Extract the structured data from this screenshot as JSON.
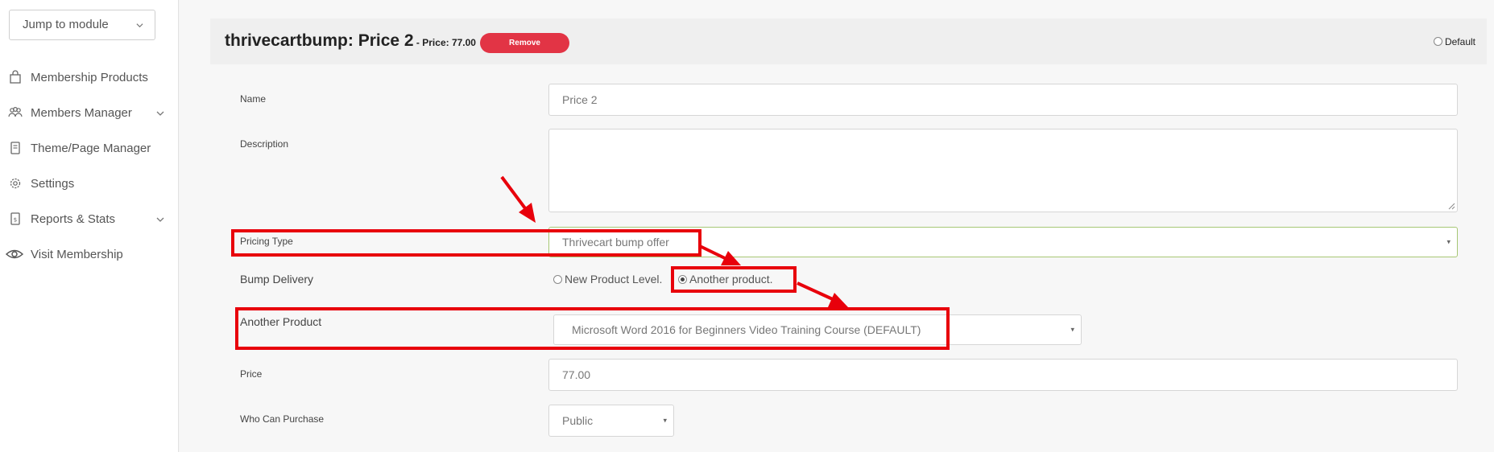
{
  "sidebar": {
    "jump_label": "Jump to module",
    "items": [
      {
        "label": "Membership Products",
        "icon": "bag-icon",
        "has_chevron": false
      },
      {
        "label": "Members Manager",
        "icon": "users-icon",
        "has_chevron": true
      },
      {
        "label": "Theme/Page Manager",
        "icon": "page-icon",
        "has_chevron": false
      },
      {
        "label": "Settings",
        "icon": "gear-icon",
        "has_chevron": false
      },
      {
        "label": "Reports & Stats",
        "icon": "report-icon",
        "has_chevron": true
      },
      {
        "label": "Visit Membership",
        "icon": "eye-icon",
        "has_chevron": false
      }
    ]
  },
  "card": {
    "title": "thrivecartbump: Price 2",
    "price_suffix": " - Price: 77.00",
    "remove_label": "Remove",
    "default_label": "Default"
  },
  "form": {
    "name_label": "Name",
    "name_value": "Price 2",
    "description_label": "Description",
    "description_value": "",
    "pricing_type_label": "Pricing Type",
    "pricing_type_value": "Thrivecart bump offer",
    "bump_delivery_label": "Bump Delivery",
    "bump_option_1": "New Product Level.",
    "bump_option_2": "Another product.",
    "bump_selected": "Another product.",
    "another_product_label": "Another Product",
    "another_product_value": "Microsoft Word 2016 for Beginners Video Training Course (DEFAULT)",
    "price_label": "Price",
    "price_value": "77.00",
    "who_label": "Who Can Purchase",
    "who_value": "Public"
  },
  "colors": {
    "accent_red": "#e23445",
    "annotation_red": "#e8000b",
    "focus_green": "#a7c775"
  }
}
